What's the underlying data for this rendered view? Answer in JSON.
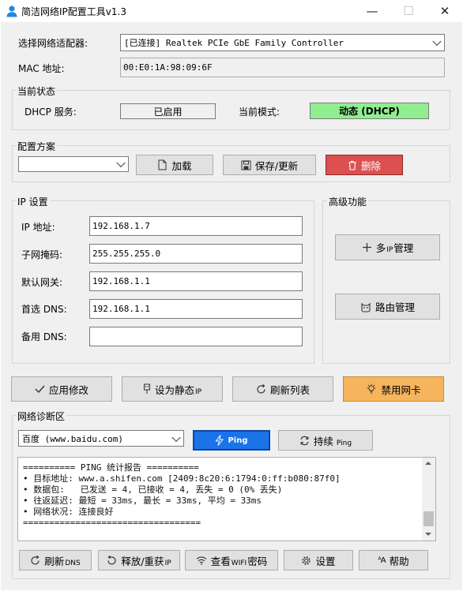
{
  "window": {
    "title": "简洁网络IP配置工具v1.3",
    "minimize": "—",
    "maximize": "☐",
    "close": "✕"
  },
  "adapter": {
    "label": "选择网络适配器:",
    "selected": "[已连接] Realtek PCIe GbE Family Controller",
    "mac_label": "MAC 地址:",
    "mac_value": "00:E0:1A:98:09:6F"
  },
  "status": {
    "title": "当前状态",
    "dhcp_label": "DHCP 服务:",
    "dhcp_value": "已启用",
    "mode_label": "当前模式:",
    "mode_value": "动态 (DHCP)",
    "mode_color": "#90ee90"
  },
  "profile": {
    "title": "配置方案",
    "selected": "",
    "load_label": "加载",
    "save_label": "保存/更新",
    "delete_label": "删除",
    "delete_color": "#dc5050"
  },
  "ip_settings": {
    "title": "IP 设置",
    "ip_label": "IP 地址:",
    "ip_value": "192.168.1.7",
    "mask_label": "子网掩码:",
    "mask_value": "255.255.255.0",
    "gateway_label": "默认网关:",
    "gateway_value": "192.168.1.1",
    "dns1_label": "首选 DNS:",
    "dns1_value": "192.168.1.1",
    "dns2_label": "备用 DNS:",
    "dns2_value": ""
  },
  "advanced": {
    "title": "高级功能",
    "multi_ip_main": "多",
    "multi_ip_small": "IP",
    "multi_ip_tail": "管理",
    "route_label": "路由管理"
  },
  "actions": {
    "apply_label": "应用修改",
    "static_main": "设为静态",
    "static_small": "IP",
    "refresh_label": "刷新列表",
    "disable_label": "禁用网卡",
    "disable_color": "#f6b55c"
  },
  "diagnostics": {
    "title": "网络诊断区",
    "target": "百度 (www.baidu.com)",
    "ping_label": "Ping",
    "ping_color": "#1a73e8",
    "continuous_main": "持续",
    "continuous_small": "Ping",
    "log_lines": [
      "========== PING 统计报告 ==========",
      "• 目标地址: www.a.shifen.com [2409:8c20:6:1794:0:ff:b080:87f0]",
      "• 数据包:   已发送 = 4, 已接收 = 4, 丢失 = 0 (0% 丢失)",
      "• 往返延迟: 最短 = 33ms, 最长 = 33ms, 平均 = 33ms",
      "• 网络状况: 连接良好",
      "=================================="
    ]
  },
  "footer": {
    "refresh_dns_main": "刷新",
    "refresh_dns_small": "DNS",
    "release_main": "释放/重获",
    "release_small": "IP",
    "wifi_main": "查看",
    "wifi_small": "WIFI",
    "wifi_tail": "密码",
    "settings_label": "设置",
    "help_label": "帮助"
  }
}
